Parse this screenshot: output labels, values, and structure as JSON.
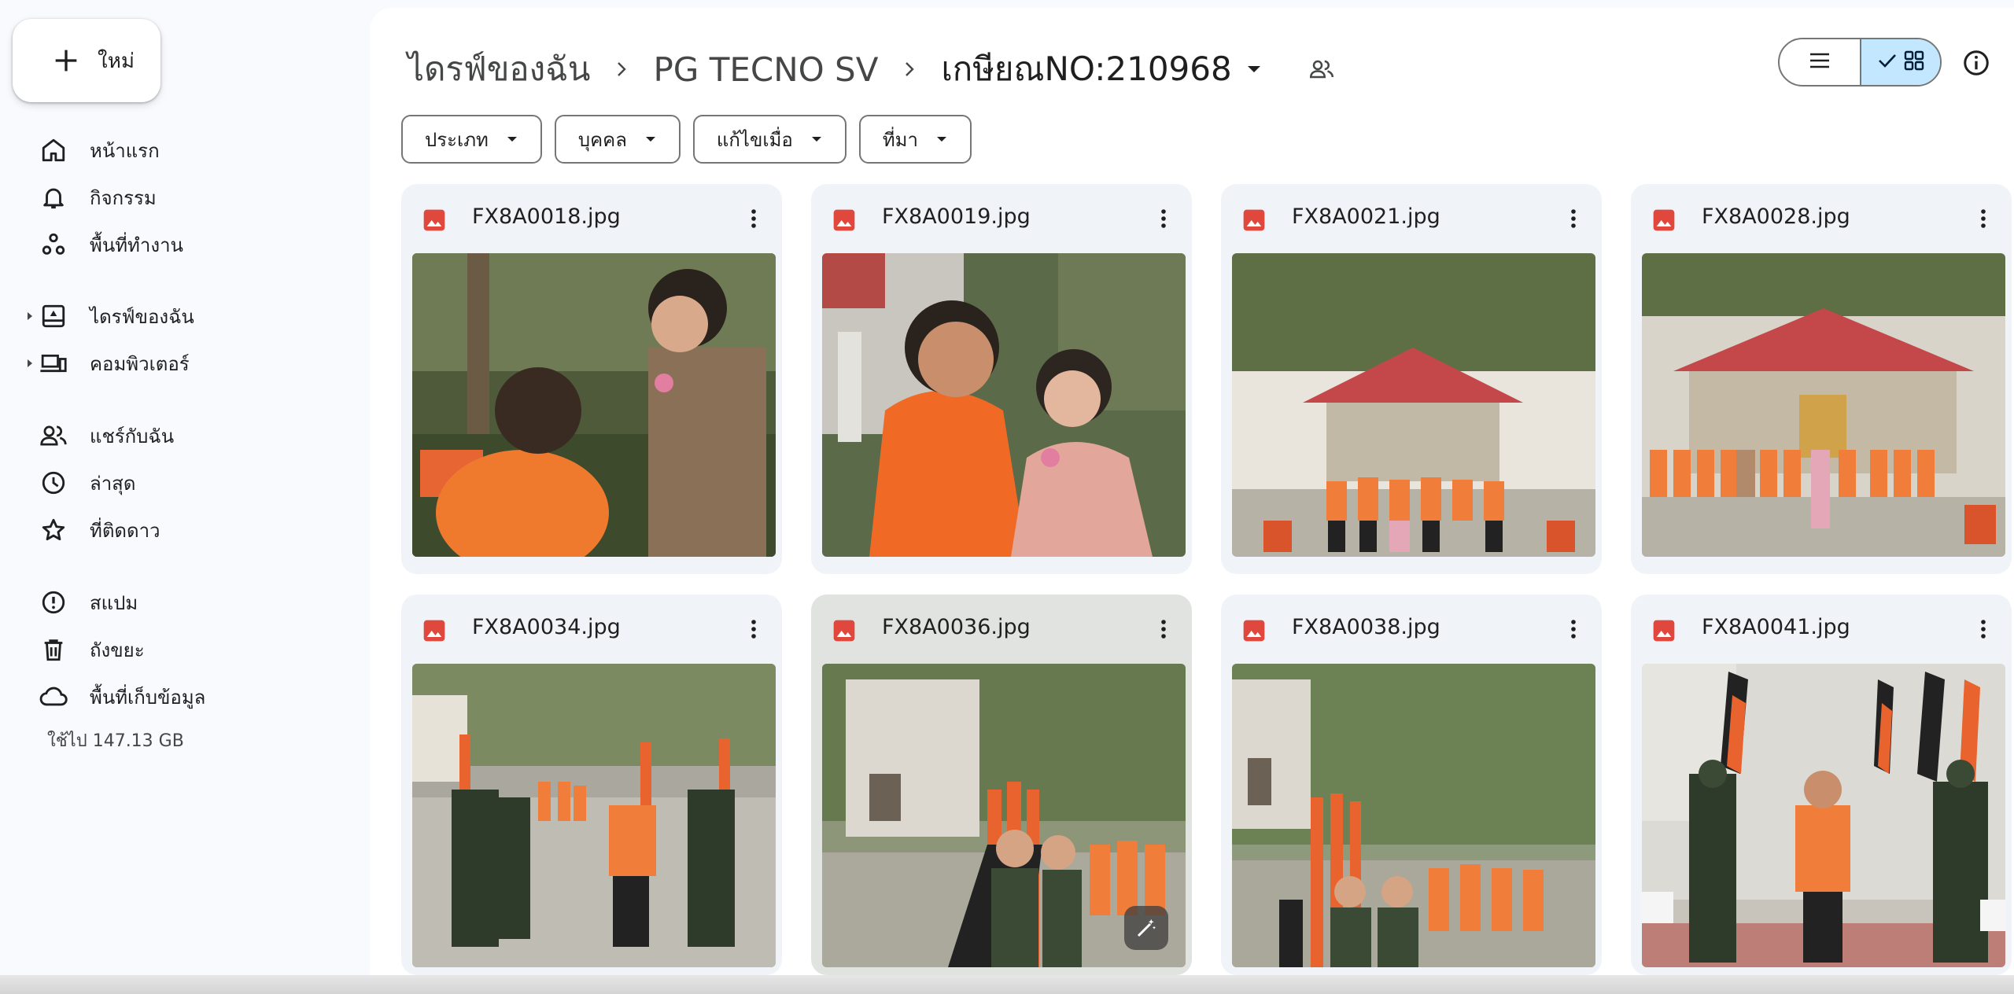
{
  "sidebar": {
    "new_label": "ใหม่",
    "items": [
      {
        "label": "หน้าแรก",
        "icon": "home-icon"
      },
      {
        "label": "กิจกรรม",
        "icon": "bell-icon"
      },
      {
        "label": "พื้นที่ทำงาน",
        "icon": "workspaces-icon"
      },
      {
        "label": "ไดรฟ์ของฉัน",
        "icon": "my-drive-icon"
      },
      {
        "label": "คอมพิวเตอร์",
        "icon": "computers-icon"
      },
      {
        "label": "แชร์กับฉัน",
        "icon": "people-icon"
      },
      {
        "label": "ล่าสุด",
        "icon": "clock-icon"
      },
      {
        "label": "ที่ติดดาว",
        "icon": "star-icon"
      },
      {
        "label": "สแปม",
        "icon": "spam-icon"
      },
      {
        "label": "ถังขยะ",
        "icon": "trash-icon"
      },
      {
        "label": "พื้นที่เก็บข้อมูล",
        "icon": "cloud-icon"
      }
    ],
    "storage_used": "ใช้ไป 147.13 GB"
  },
  "breadcrumb": {
    "items": [
      "ไดรฟ์ของฉัน",
      "PG TECNO SV",
      "เกษียณNO:210968"
    ]
  },
  "filters": [
    "ประเภท",
    "บุคคล",
    "แก้ไขเมื่อ",
    "ที่มา"
  ],
  "view": {
    "mode": "grid"
  },
  "files": [
    {
      "name": "FX8A0018.jpg"
    },
    {
      "name": "FX8A0019.jpg"
    },
    {
      "name": "FX8A0021.jpg"
    },
    {
      "name": "FX8A0028.jpg"
    },
    {
      "name": "FX8A0034.jpg"
    },
    {
      "name": "FX8A0036.jpg"
    },
    {
      "name": "FX8A0038.jpg"
    },
    {
      "name": "FX8A0041.jpg"
    }
  ],
  "colors": {
    "accent": "#0b57d0",
    "selected": "#c2e7ff",
    "image_icon": "#e0483e",
    "card_bg": "#f0f4f9"
  }
}
